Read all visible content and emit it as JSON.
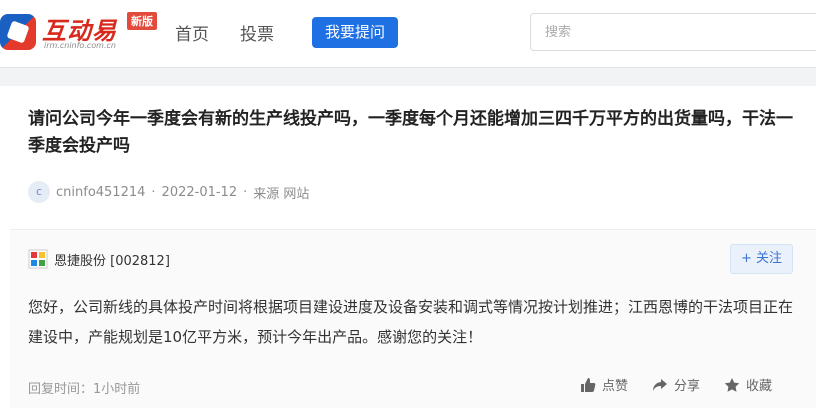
{
  "header": {
    "logo_text": "互动易",
    "logo_sub": "irm.cninfo.com.cn",
    "logo_badge": "新版",
    "nav": [
      "首页",
      "投票"
    ],
    "ask_button": "我要提问",
    "search_placeholder": "搜索"
  },
  "question": {
    "title": "请问公司今年一季度会有新的生产线投产吗，一季度每个月还能增加三四千万平方的出货量吗，干法一季度会投产吗",
    "avatar_letter": "c",
    "author": "cninfo451214",
    "date": "2022-01-12",
    "source": "来源 网站"
  },
  "answer": {
    "company": "恩捷股份 [002812]",
    "follow_label": "关注",
    "text": "您好，公司新线的具体投产时间将根据项目建设进度及设备安装和调式等情况按计划推进；江西恩博的干法项目正在建设中，产能规划是10亿平方米，预计今年出产品。感谢您的关注！",
    "reply_time": "回复时间：1小时前",
    "actions": {
      "like": "点赞",
      "share": "分享",
      "collect": "收藏"
    }
  },
  "colors": {
    "primary": "#1f70e3",
    "brand_red": "#d9291c"
  }
}
